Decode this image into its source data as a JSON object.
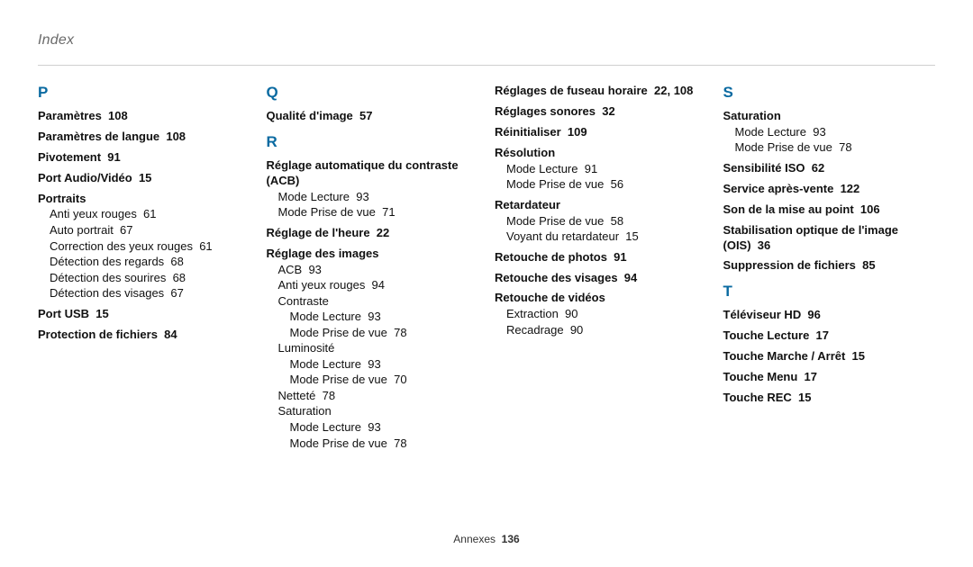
{
  "header": "Index",
  "footer": {
    "section": "Annexes",
    "page": "136"
  },
  "columns": [
    [
      {
        "type": "letter",
        "text": "P"
      },
      {
        "type": "entry",
        "title": "Paramètres",
        "pages": "108"
      },
      {
        "type": "entry",
        "title": "Paramètres de langue",
        "pages": "108"
      },
      {
        "type": "entry",
        "title": "Pivotement",
        "pages": "91"
      },
      {
        "type": "entry",
        "title": "Port Audio/Vidéo",
        "pages": "15"
      },
      {
        "type": "entry",
        "title": "Portraits",
        "children": [
          {
            "label": "Anti yeux rouges",
            "pages": "61"
          },
          {
            "label": "Auto portrait",
            "pages": "67"
          },
          {
            "label": "Correction des yeux rouges",
            "pages": "61"
          },
          {
            "label": "Détection des regards",
            "pages": "68"
          },
          {
            "label": "Détection des sourires",
            "pages": "68"
          },
          {
            "label": "Détection des visages",
            "pages": "67"
          }
        ]
      },
      {
        "type": "entry",
        "title": "Port USB",
        "pages": "15"
      },
      {
        "type": "entry",
        "title": "Protection de fichiers",
        "pages": "84"
      }
    ],
    [
      {
        "type": "letter",
        "text": "Q"
      },
      {
        "type": "entry",
        "title": "Qualité d'image",
        "pages": "57"
      },
      {
        "type": "letter",
        "text": "R"
      },
      {
        "type": "entry",
        "title": "Réglage automatique du contraste (ACB)",
        "children": [
          {
            "label": "Mode Lecture",
            "pages": "93"
          },
          {
            "label": "Mode Prise de vue",
            "pages": "71"
          }
        ]
      },
      {
        "type": "entry",
        "title": "Réglage de l'heure",
        "pages": "22"
      },
      {
        "type": "entry",
        "title": "Réglage des images",
        "children": [
          {
            "label": "ACB",
            "pages": "93"
          },
          {
            "label": "Anti yeux rouges",
            "pages": "94"
          },
          {
            "label": "Contraste",
            "children2": [
              {
                "label": "Mode Lecture",
                "pages": "93"
              },
              {
                "label": "Mode Prise de vue",
                "pages": "78"
              }
            ]
          },
          {
            "label": "Luminosité",
            "children2": [
              {
                "label": "Mode Lecture",
                "pages": "93"
              },
              {
                "label": "Mode Prise de vue",
                "pages": "70"
              }
            ]
          },
          {
            "label": "Netteté",
            "pages": "78"
          },
          {
            "label": "Saturation",
            "children2": [
              {
                "label": "Mode Lecture",
                "pages": "93"
              },
              {
                "label": "Mode Prise de vue",
                "pages": "78"
              }
            ]
          }
        ]
      }
    ],
    [
      {
        "type": "entry",
        "title": "Réglages de fuseau horaire",
        "pages": "22, 108"
      },
      {
        "type": "entry",
        "title": "Réglages sonores",
        "pages": "32"
      },
      {
        "type": "entry",
        "title": "Réinitialiser",
        "pages": "109"
      },
      {
        "type": "entry",
        "title": "Résolution",
        "children": [
          {
            "label": "Mode Lecture",
            "pages": "91"
          },
          {
            "label": "Mode Prise de vue",
            "pages": "56"
          }
        ]
      },
      {
        "type": "entry",
        "title": "Retardateur",
        "children": [
          {
            "label": "Mode Prise de vue",
            "pages": "58"
          },
          {
            "label": "Voyant du retardateur",
            "pages": "15"
          }
        ]
      },
      {
        "type": "entry",
        "title": "Retouche de photos",
        "pages": "91"
      },
      {
        "type": "entry",
        "title": "Retouche des visages",
        "pages": "94"
      },
      {
        "type": "entry",
        "title": "Retouche de vidéos",
        "children": [
          {
            "label": "Extraction",
            "pages": "90"
          },
          {
            "label": "Recadrage",
            "pages": "90"
          }
        ]
      }
    ],
    [
      {
        "type": "letter",
        "text": "S"
      },
      {
        "type": "entry",
        "title": "Saturation",
        "children": [
          {
            "label": "Mode Lecture",
            "pages": "93"
          },
          {
            "label": "Mode Prise de vue",
            "pages": "78"
          }
        ]
      },
      {
        "type": "entry",
        "title": "Sensibilité ISO",
        "pages": "62"
      },
      {
        "type": "entry",
        "title": "Service après-vente",
        "pages": "122"
      },
      {
        "type": "entry",
        "title": "Son de la mise au point",
        "pages": "106"
      },
      {
        "type": "entry",
        "title": "Stabilisation optique de l'image (OIS)",
        "pages": "36"
      },
      {
        "type": "entry",
        "title": "Suppression de fichiers",
        "pages": "85"
      },
      {
        "type": "letter",
        "text": "T"
      },
      {
        "type": "entry",
        "title": "Téléviseur HD",
        "pages": "96"
      },
      {
        "type": "entry",
        "title": "Touche Lecture",
        "pages": "17"
      },
      {
        "type": "entry",
        "title": "Touche Marche / Arrêt",
        "pages": "15"
      },
      {
        "type": "entry",
        "title": "Touche Menu",
        "pages": "17"
      },
      {
        "type": "entry",
        "title": "Touche REC",
        "pages": "15"
      }
    ]
  ]
}
